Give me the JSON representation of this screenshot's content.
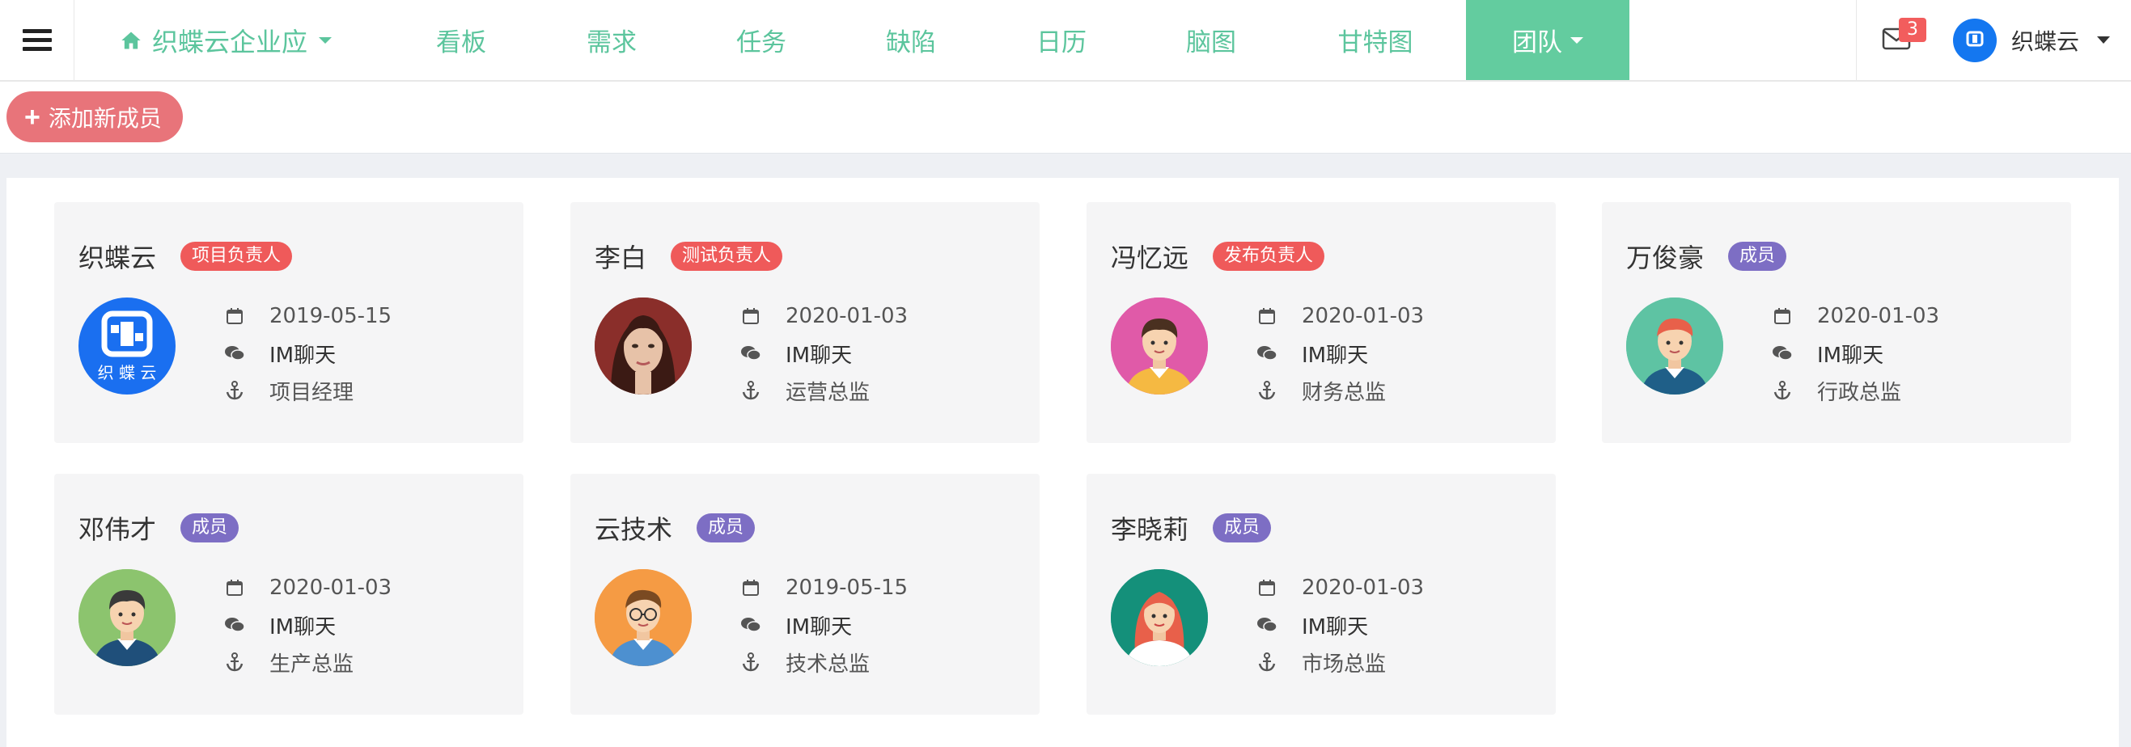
{
  "navbar": {
    "brand_label": "织蝶云企业应",
    "items": [
      {
        "label": "看板"
      },
      {
        "label": "需求"
      },
      {
        "label": "任务"
      },
      {
        "label": "缺陷"
      },
      {
        "label": "日历"
      },
      {
        "label": "脑图"
      },
      {
        "label": "甘特图"
      },
      {
        "label": "团队",
        "active": true
      }
    ],
    "mail_count": "3",
    "user_name": "织蝶云",
    "icons": [
      "menu-icon",
      "home-icon",
      "chevron-down-icon",
      "mail-icon"
    ]
  },
  "toolbar": {
    "add_member_label": "添加新成员"
  },
  "colors": {
    "accent": "#5cc59d",
    "active_tab": "#63cc9f",
    "add_button": "#e8747a",
    "badge_red": "#ef5a5a",
    "badge_purple": "#7d6ec4"
  },
  "members": [
    {
      "name": "织蝶云",
      "role": "项目负责人",
      "role_color": "red",
      "date": "2019-05-15",
      "chat": "IM聊天",
      "title": "项目经理",
      "avatar": "logo-avatar"
    },
    {
      "name": "李白",
      "role": "测试负责人",
      "role_color": "red",
      "date": "2020-01-03",
      "chat": "IM聊天",
      "title": "运营总监",
      "avatar": "woman-photo-avatar"
    },
    {
      "name": "冯忆远",
      "role": "发布负责人",
      "role_color": "red",
      "date": "2020-01-03",
      "chat": "IM聊天",
      "title": "财务总监",
      "avatar": "man-pink-avatar"
    },
    {
      "name": "万俊豪",
      "role": "成员",
      "role_color": "purple",
      "date": "2020-01-03",
      "chat": "IM聊天",
      "title": "行政总监",
      "avatar": "man-teal-avatar"
    },
    {
      "name": "邓伟才",
      "role": "成员",
      "role_color": "purple",
      "date": "2020-01-03",
      "chat": "IM聊天",
      "title": "生产总监",
      "avatar": "man-green-avatar"
    },
    {
      "name": "云技术",
      "role": "成员",
      "role_color": "purple",
      "date": "2019-05-15",
      "chat": "IM聊天",
      "title": "技术总监",
      "avatar": "man-orange-avatar"
    },
    {
      "name": "李晓莉",
      "role": "成员",
      "role_color": "purple",
      "date": "2020-01-03",
      "chat": "IM聊天",
      "title": "市场总监",
      "avatar": "woman-teal-avatar"
    }
  ]
}
